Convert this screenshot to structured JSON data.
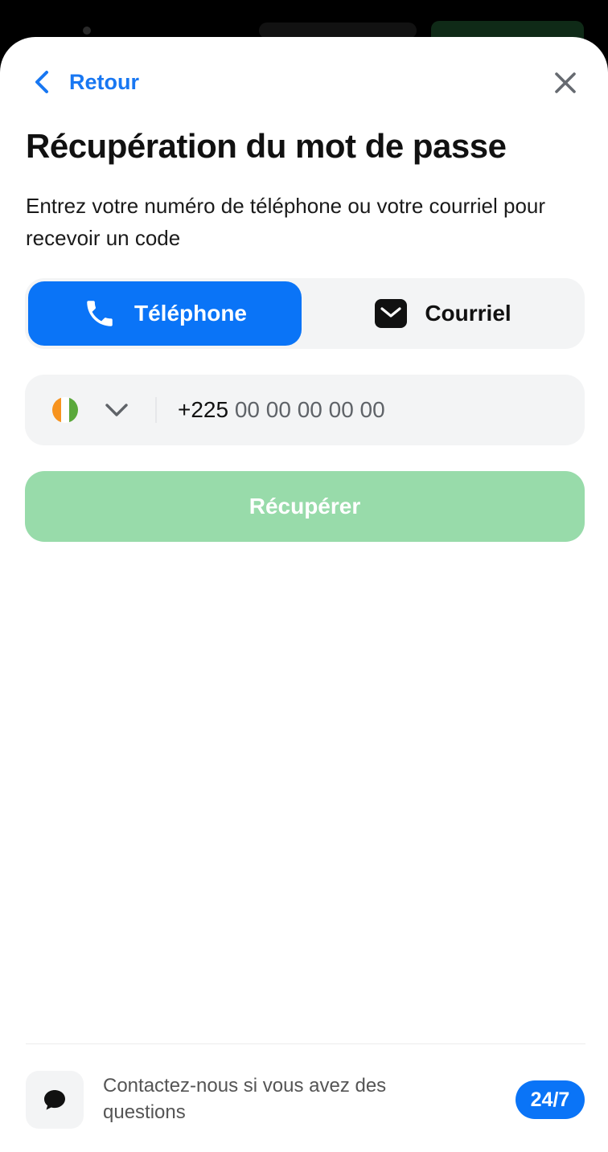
{
  "header": {
    "back_label": "Retour",
    "back_icon": "chevron-left-icon",
    "close_icon": "close-icon"
  },
  "title": "Récupération du mot de passe",
  "subtitle": "Entrez votre numéro de téléphone ou votre courriel pour recevoir un code",
  "method_tabs": [
    {
      "label": "Téléphone",
      "icon": "phone-icon",
      "selected": true
    },
    {
      "label": "Courriel",
      "icon": "mail-icon",
      "selected": false
    }
  ],
  "phone_field": {
    "country_flag": "cote-divoire-flag",
    "dial_code": "+225",
    "placeholder": "00 00 00 00 00"
  },
  "submit_label": "Récupérer",
  "footer": {
    "contact_text": "Contactez-nous si vous avez des questions",
    "badge": "24/7",
    "chat_icon": "chat-bubble-icon"
  },
  "colors": {
    "accent": "#0a74f7",
    "back_link": "#1877f2",
    "submit_disabled": "#98dbaa",
    "field_bg": "#f3f4f5",
    "flag_orange": "#f7931e",
    "flag_white": "#ffffff",
    "flag_green": "#5aa83b"
  }
}
